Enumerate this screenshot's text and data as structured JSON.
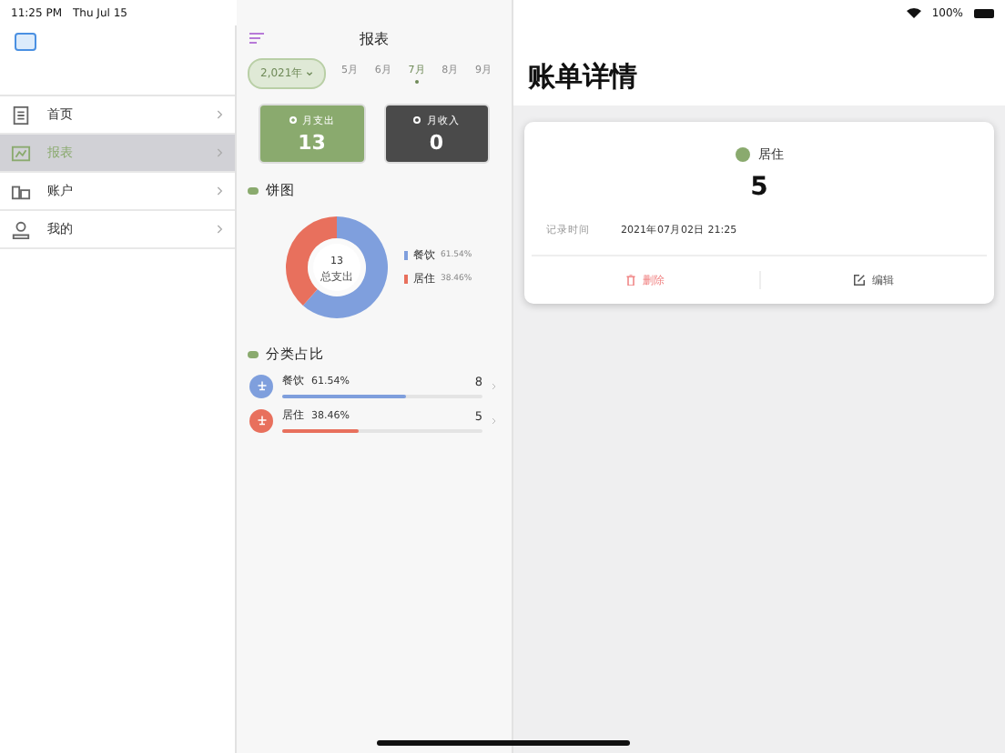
{
  "status_bar": {
    "time": "11:25 PM",
    "date": "Thu Jul 15",
    "battery": "100%"
  },
  "sidebar": {
    "items": [
      {
        "label": "首页",
        "kind": "document",
        "selected": false
      },
      {
        "label": "报表",
        "kind": "chart",
        "selected": true
      },
      {
        "label": "账户",
        "kind": "account",
        "selected": false
      },
      {
        "label": "我的",
        "kind": "person",
        "selected": false
      }
    ]
  },
  "report": {
    "title": "报表",
    "year": "2,021年",
    "months": [
      {
        "label": "5月",
        "selected": false
      },
      {
        "label": "6月",
        "selected": false
      },
      {
        "label": "7月",
        "selected": true
      },
      {
        "label": "8月",
        "selected": false
      },
      {
        "label": "9月",
        "selected": false
      }
    ],
    "cards": [
      {
        "label": "月支出",
        "value": "13",
        "selected": true
      },
      {
        "label": "月收入",
        "value": "0",
        "selected": false
      }
    ],
    "pie": {
      "title": "饼图",
      "center_value": "13",
      "center_label": "总支出",
      "legend": [
        {
          "percent": "61.54%",
          "color": "#7f9fdd"
        },
        {
          "percent": "38.46%",
          "color": "#e8705d"
        }
      ],
      "chart_data": {
        "type": "donut",
        "categories": [
          "餐饮",
          "居住"
        ],
        "values": [
          61.54,
          38.46
        ]
      }
    },
    "categories": {
      "title": "分类占比",
      "items": [
        {
          "name": "餐饮",
          "percent": "61.54%",
          "amount": "8",
          "level": 0.6154,
          "color": "#7f9fdd"
        },
        {
          "name": "居住",
          "percent": "38.46%",
          "amount": "5",
          "level": 0.3846,
          "color": "#e8705d"
        }
      ]
    }
  },
  "detail": {
    "title": "账单详情",
    "category": "居住",
    "amount": "5",
    "record_label": "记录时间",
    "record_time": "2021年07月02日 21:25",
    "actions": [
      {
        "kind": "delete",
        "label": "删除"
      },
      {
        "kind": "edit",
        "label": "编辑"
      }
    ]
  }
}
